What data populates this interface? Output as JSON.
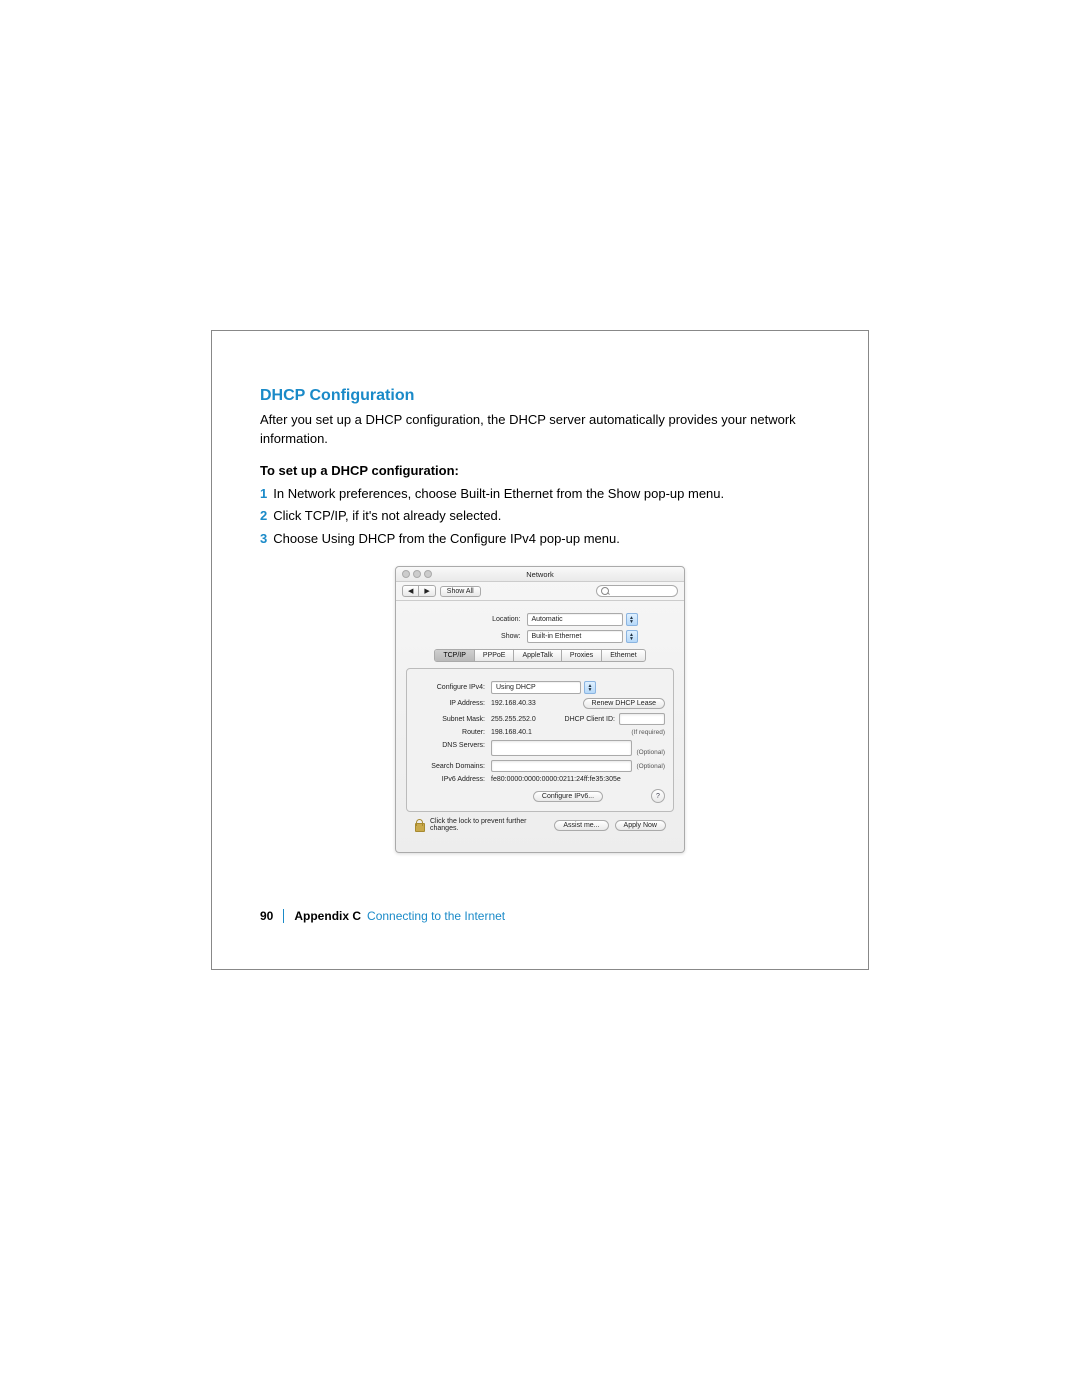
{
  "header": {
    "title": "DHCP Configuration",
    "intro": "After you set up a DHCP configuration, the DHCP server automatically provides your network information.",
    "subhead": "To set up a DHCP configuration:"
  },
  "steps": [
    "In Network preferences, choose Built-in Ethernet from the Show pop-up menu.",
    "Click TCP/IP, if it's not already selected.",
    "Choose Using DHCP from the Configure IPv4 pop-up menu."
  ],
  "window": {
    "title": "Network",
    "toolbar": {
      "back": "◀",
      "fwd": "▶",
      "show_all": "Show All",
      "search_placeholder": "Q"
    },
    "selects": {
      "location_label": "Location:",
      "location_value": "Automatic",
      "show_label": "Show:",
      "show_value": "Built-in Ethernet"
    },
    "tabs": [
      "TCP/IP",
      "PPPoE",
      "AppleTalk",
      "Proxies",
      "Ethernet"
    ],
    "fields": {
      "configure_label": "Configure IPv4:",
      "configure_value": "Using DHCP",
      "ip_label": "IP Address:",
      "ip_value": "192.168.40.33",
      "subnet_label": "Subnet Mask:",
      "subnet_value": "255.255.252.0",
      "router_label": "Router:",
      "router_value": "198.168.40.1",
      "renew_btn": "Renew DHCP Lease",
      "client_id_label": "DHCP Client ID:",
      "client_id_hint": "(If required)",
      "dns_label": "DNS Servers:",
      "dns_hint": "(Optional)",
      "domains_label": "Search Domains:",
      "domains_hint": "(Optional)",
      "ipv6_label": "IPv6 Address:",
      "ipv6_value": "fe80:0000:0000:0000:0211:24ff:fe35:305e",
      "config_ipv6_btn": "Configure IPv6...",
      "help": "?"
    },
    "footer": {
      "lock_text": "Click the lock to prevent further changes.",
      "assist": "Assist me...",
      "apply": "Apply Now"
    }
  },
  "page_footer": {
    "page_num": "90",
    "appendix": "Appendix C",
    "chapter": "Connecting to the Internet"
  }
}
